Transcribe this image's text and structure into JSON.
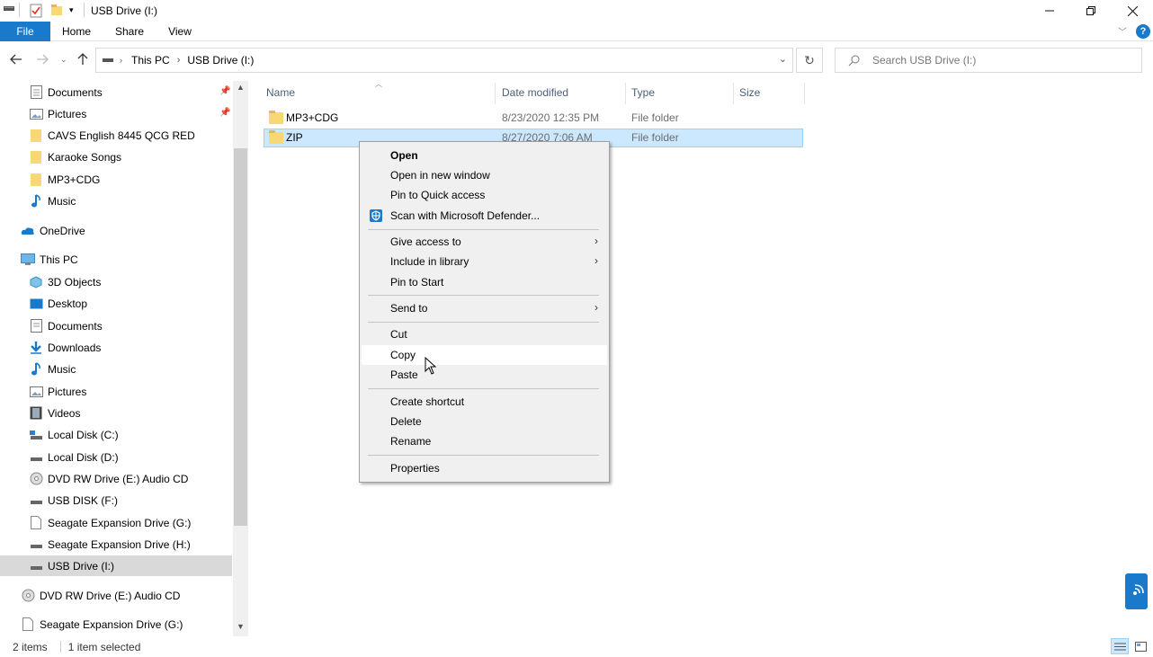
{
  "window": {
    "title": "USB Drive (I:)"
  },
  "ribbon": {
    "tabs": [
      "File",
      "Home",
      "Share",
      "View"
    ],
    "help_label": "?"
  },
  "address": {
    "breadcrumb": [
      "This PC",
      "USB Drive (I:)"
    ],
    "search_placeholder": "Search USB Drive (I:)"
  },
  "navpane": {
    "quick_access": [
      {
        "label": "Documents",
        "icon": "documents-icon",
        "pinned": true
      },
      {
        "label": "Pictures",
        "icon": "pictures-icon",
        "pinned": true
      },
      {
        "label": "CAVS English 8445 QCG RED",
        "icon": "folder-icon"
      },
      {
        "label": "Karaoke Songs",
        "icon": "folder-icon"
      },
      {
        "label": "MP3+CDG",
        "icon": "folder-icon"
      },
      {
        "label": "Music",
        "icon": "music-icon"
      }
    ],
    "onedrive": "OneDrive",
    "this_pc": "This PC",
    "this_pc_items": [
      {
        "label": "3D Objects",
        "icon": "3d-objects-icon"
      },
      {
        "label": "Desktop",
        "icon": "desktop-icon"
      },
      {
        "label": "Documents",
        "icon": "documents-icon"
      },
      {
        "label": "Downloads",
        "icon": "downloads-icon"
      },
      {
        "label": "Music",
        "icon": "music-icon"
      },
      {
        "label": "Pictures",
        "icon": "pictures-icon"
      },
      {
        "label": "Videos",
        "icon": "videos-icon"
      },
      {
        "label": "Local Disk (C:)",
        "icon": "drive-icon"
      },
      {
        "label": "Local Disk (D:)",
        "icon": "drive-icon"
      },
      {
        "label": "DVD RW Drive (E:) Audio CD",
        "icon": "cd-icon"
      },
      {
        "label": "USB DISK (F:)",
        "icon": "drive-icon"
      },
      {
        "label": "Seagate Expansion Drive (G:)",
        "icon": "file-icon"
      },
      {
        "label": "Seagate Expansion Drive (H:)",
        "icon": "drive-icon"
      },
      {
        "label": "USB Drive (I:)",
        "icon": "drive-icon",
        "selected": true
      }
    ],
    "bottom_items": [
      {
        "label": "DVD RW Drive (E:) Audio CD",
        "icon": "cd-icon"
      },
      {
        "label": "Seagate Expansion Drive (G:)",
        "icon": "file-icon"
      }
    ]
  },
  "filelist": {
    "columns": [
      "Name",
      "Date modified",
      "Type",
      "Size"
    ],
    "rows": [
      {
        "name": "MP3+CDG",
        "date": "8/23/2020 12:35 PM",
        "type": "File folder",
        "size": ""
      },
      {
        "name": "ZIP",
        "date": "8/27/2020 7:06 AM",
        "type": "File folder",
        "size": "",
        "selected": true
      }
    ]
  },
  "context_menu": {
    "groups": [
      [
        "Open",
        "Open in new window",
        "Pin to Quick access",
        "Scan with Microsoft Defender..."
      ],
      [
        "Give access to",
        "Include in library",
        "Pin to Start"
      ],
      [
        "Send to"
      ],
      [
        "Cut",
        "Copy",
        "Paste"
      ],
      [
        "Create shortcut",
        "Delete",
        "Rename"
      ],
      [
        "Properties"
      ]
    ],
    "hovered": "Copy"
  },
  "status": {
    "item_count": "2 items",
    "selection": "1 item selected"
  },
  "colors": {
    "accent": "#1979ca",
    "selection": "#cce8ff",
    "menu_bg": "#f0f0f0"
  }
}
